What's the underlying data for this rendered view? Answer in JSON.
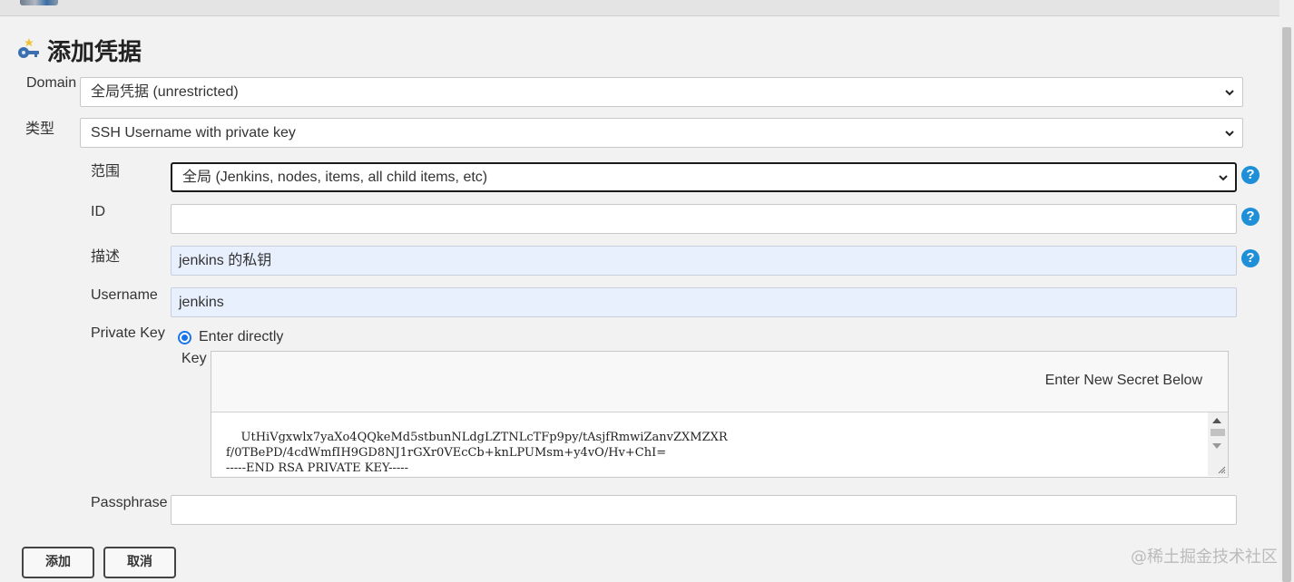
{
  "page": {
    "title": "添加凭据"
  },
  "form": {
    "domain": {
      "label": "Domain",
      "value": "全局凭据 (unrestricted)"
    },
    "kind": {
      "label": "类型",
      "value": "SSH Username with private key"
    },
    "scope": {
      "label": "范围",
      "value": "全局 (Jenkins, nodes, items, all child items, etc)"
    },
    "id": {
      "label": "ID",
      "value": ""
    },
    "description": {
      "label": "描述",
      "value": "jenkins 的私钥"
    },
    "username": {
      "label": "Username",
      "value": "jenkins"
    },
    "private_key": {
      "label": "Private Key",
      "option": "Enter directly",
      "key_label": "Key",
      "hint": "Enter New Secret Below",
      "content": "UtHiVgxwlx7yaXo4QQkeMd5stbunNLdgLZTNLcTFp9py/tAsjfRmwiZanvZXMZXR\nf/0TBePD/4cdWmfIH9GD8NJ1rGXr0VEcCb+knLPUMsm+y4vO/Hv+ChI=\n-----END RSA PRIVATE KEY-----"
    },
    "passphrase": {
      "label": "Passphrase",
      "value": ""
    }
  },
  "help": {
    "symbol": "?"
  },
  "buttons": {
    "add": "添加",
    "cancel": "取消"
  },
  "watermark": "@稀土掘金技术社区",
  "colors": {
    "accent": "#1f8fd8",
    "autofill": "#e8f0fe",
    "background": "#f2f2f2"
  }
}
